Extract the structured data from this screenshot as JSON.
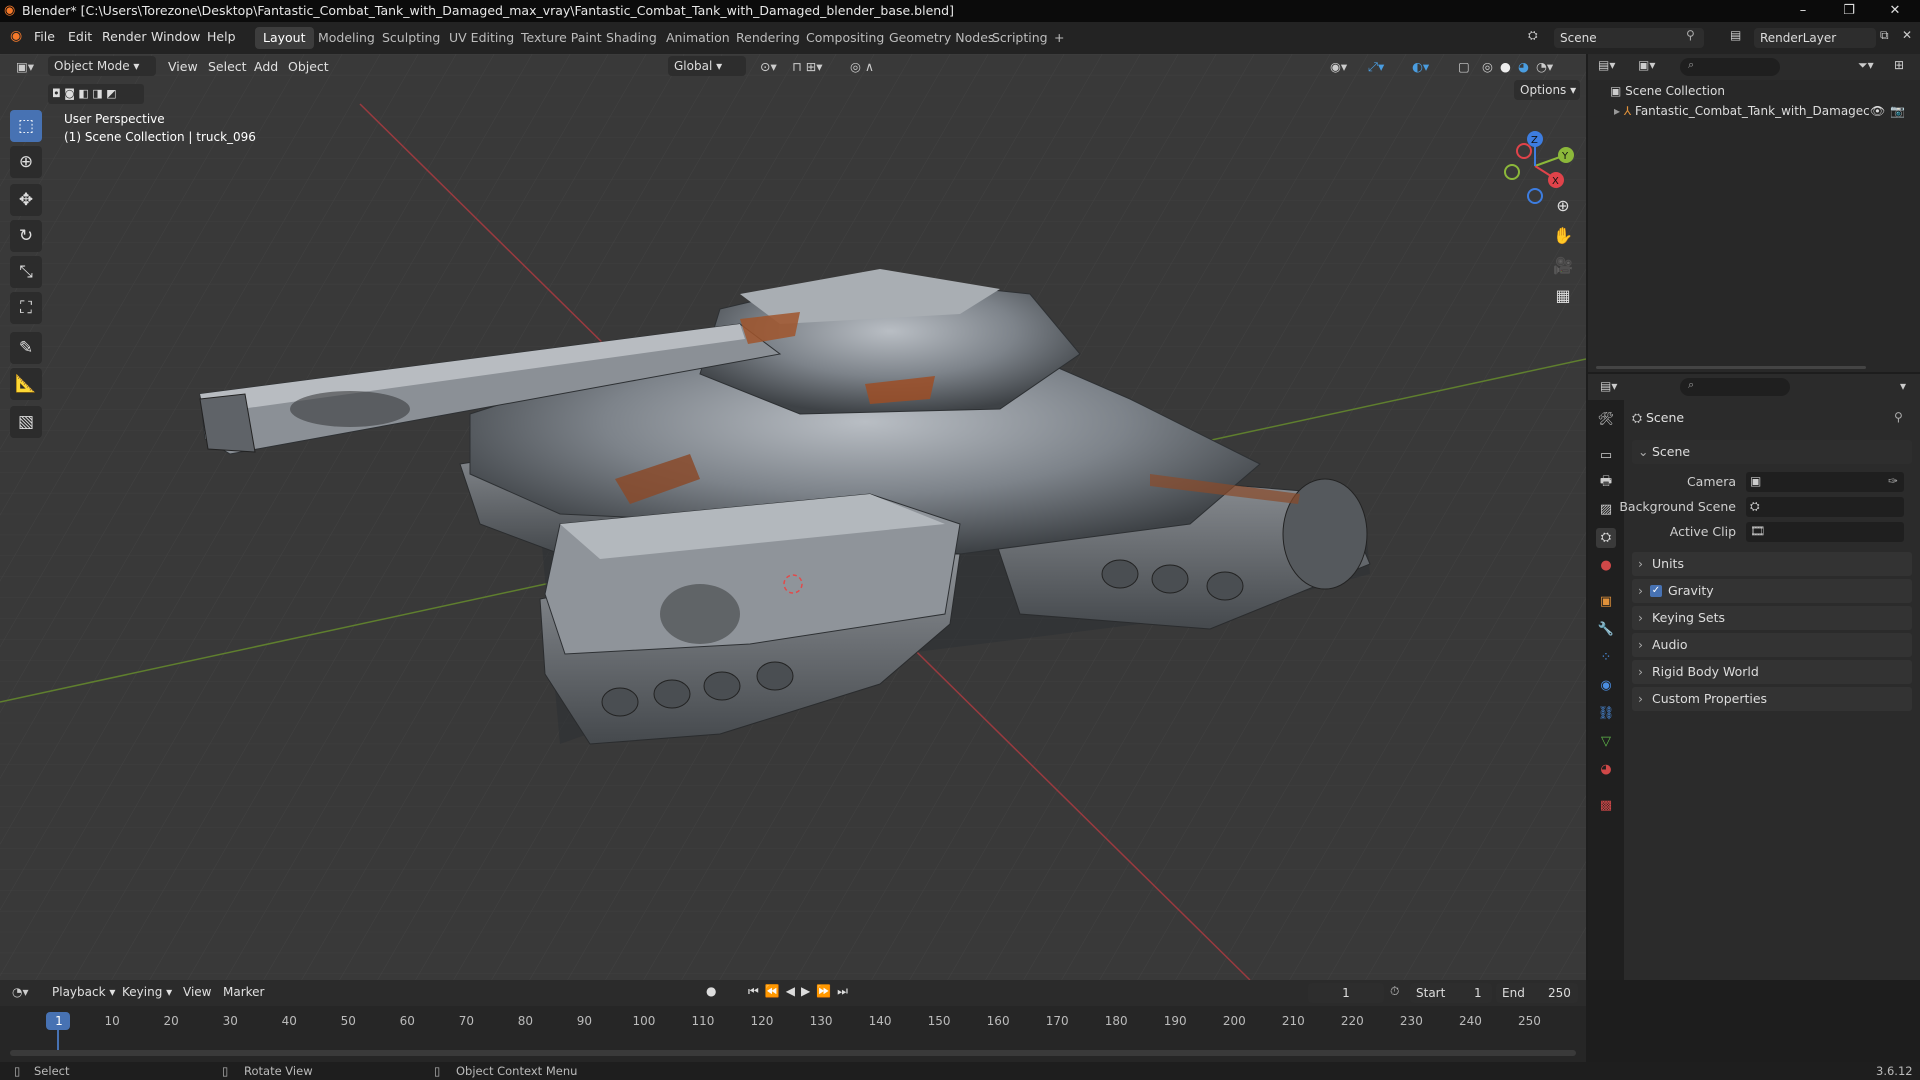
{
  "window": {
    "title": "Blender* [C:\\Users\\Torezone\\Desktop\\Fantastic_Combat_Tank_with_Damaged_max_vray\\Fantastic_Combat_Tank_with_Damaged_blender_base.blend]",
    "minimize": "–",
    "maximize": "❐",
    "close": "✕"
  },
  "menu": [
    "File",
    "Edit",
    "Render",
    "Window",
    "Help"
  ],
  "workspaces": [
    "Layout",
    "Modeling",
    "Sculpting",
    "UV Editing",
    "Texture Paint",
    "Shading",
    "Animation",
    "Rendering",
    "Compositing",
    "Geometry Nodes",
    "Scripting",
    "+"
  ],
  "scene_field": "Scene",
  "renderlayer_field": "RenderLayer",
  "viewport": {
    "mode": "Object Mode",
    "menus": [
      "View",
      "Select",
      "Add",
      "Object"
    ],
    "transform": "Global",
    "options": "Options",
    "overlay_line1": "User Perspective",
    "overlay_line2": "(1) Scene Collection | truck_096"
  },
  "gizmo": {
    "x": "X",
    "y": "Y",
    "z": "Z"
  },
  "outliner": {
    "root": "Scene Collection",
    "item": "Fantastic_Combat_Tank_with_Damagec"
  },
  "properties": {
    "header": "Scene",
    "section": "Scene",
    "camera_label": "Camera",
    "background_label": "Background Scene",
    "clip_label": "Active Clip",
    "panels": [
      "Units",
      "Gravity",
      "Keying Sets",
      "Audio",
      "Rigid Body World",
      "Custom Properties"
    ]
  },
  "timeline": {
    "menus": [
      "Playback",
      "Keying",
      "View",
      "Marker"
    ],
    "current": "1",
    "start_label": "Start",
    "start": "1",
    "end_label": "End",
    "end": "250",
    "frames": [
      "1",
      "10",
      "20",
      "30",
      "40",
      "50",
      "60",
      "70",
      "80",
      "90",
      "100",
      "110",
      "120",
      "130",
      "140",
      "150",
      "160",
      "170",
      "180",
      "190",
      "200",
      "210",
      "220",
      "230",
      "240",
      "250"
    ]
  },
  "status": {
    "select": "Select",
    "rotate": "Rotate View",
    "context": "Object Context Menu",
    "version": "3.6.12"
  },
  "colors": {
    "accent": "#4772b3",
    "x_axis": "#e0434a",
    "y_axis": "#8cb83a",
    "z_axis": "#3d7de0"
  }
}
